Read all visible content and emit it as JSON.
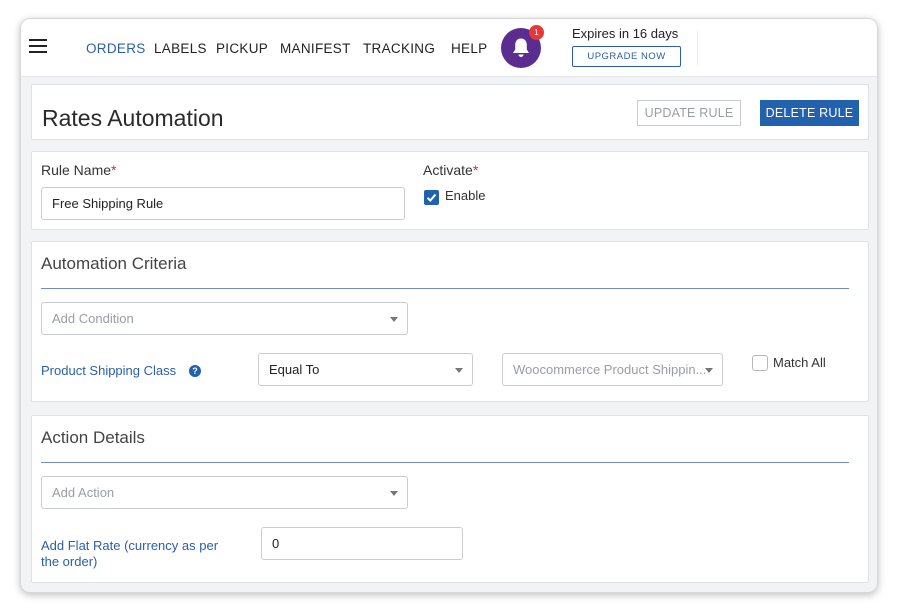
{
  "nav": {
    "items": [
      "ORDERS",
      "LABELS",
      "PICKUP",
      "MANIFEST",
      "TRACKING",
      "HELP"
    ],
    "notification_count": "1",
    "expires_text": "Expires in 16 days",
    "upgrade_label": "UPGRADE NOW"
  },
  "header": {
    "title": "Rates Automation",
    "update_label": "UPDATE RULE",
    "delete_label": "DELETE RULE"
  },
  "rule": {
    "name_label": "Rule Name",
    "name_value": "Free Shipping Rule",
    "activate_label": "Activate",
    "enable_label": "Enable",
    "enabled": true,
    "required_mark": "*"
  },
  "criteria": {
    "title": "Automation Criteria",
    "add_condition_placeholder": "Add Condition",
    "condition_label": "Product Shipping Class",
    "operator_value": "Equal To",
    "class_placeholder": "Woocommerce Product Shippin...",
    "match_all_label": "Match All"
  },
  "action": {
    "title": "Action Details",
    "add_action_placeholder": "Add Action",
    "flat_rate_label_line1": "Add Flat Rate (currency as per",
    "flat_rate_label_line2": "the order)",
    "flat_rate_value": "0"
  },
  "colors": {
    "primary": "#2161ad",
    "link": "#2b5fa8",
    "bell": "#5c2d91",
    "badge": "#e53935",
    "required": "#d32f2f"
  },
  "icons": [
    "menu-icon",
    "bell-icon",
    "check-icon",
    "help-icon",
    "chevron-down-icon"
  ]
}
